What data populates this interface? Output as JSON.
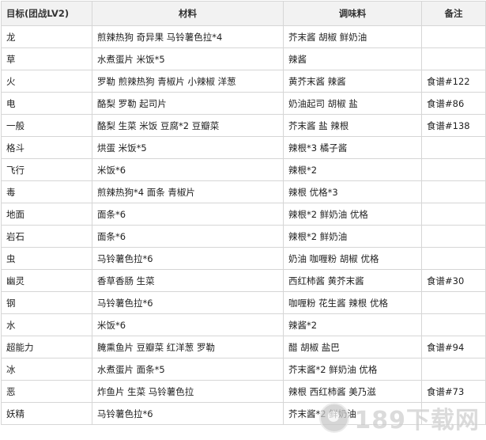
{
  "table": {
    "headers": [
      "目标(团战LV2)",
      "材料",
      "调味料",
      "备注"
    ],
    "rows": [
      [
        "龙",
        "煎辣热狗 奇异果 马铃薯色拉*4",
        "芥末酱 胡椒 鲜奶油",
        ""
      ],
      [
        "草",
        "水煮蛋片 米饭*5",
        "辣酱",
        ""
      ],
      [
        "火",
        "罗勒 煎辣热狗 青椒片 小辣椒 洋葱",
        "黄芥末酱 辣酱",
        "食谱#122"
      ],
      [
        "电",
        "酪梨 罗勒 起司片",
        "奶油起司 胡椒 盐",
        "食谱#86"
      ],
      [
        "一般",
        "酪梨 生菜 米饭 豆腐*2 豆瓣菜",
        "芥末酱 盐 辣根",
        "食谱#138"
      ],
      [
        "格斗",
        "烘蛋 米饭*5",
        "辣根*3 橘子酱",
        ""
      ],
      [
        "飞行",
        "米饭*6",
        "辣根*2",
        ""
      ],
      [
        "毒",
        "煎辣热狗*4 面条 青椒片",
        "辣根 优格*3",
        ""
      ],
      [
        "地面",
        "面条*6",
        "辣根*2 鲜奶油 优格",
        ""
      ],
      [
        "岩石",
        "面条*6",
        "辣根*2 鲜奶油",
        ""
      ],
      [
        "虫",
        "马铃薯色拉*6",
        "奶油 咖喱粉 胡椒 优格",
        ""
      ],
      [
        "幽灵",
        "香草香肠 生菜",
        "西红柿酱 黄芥末酱",
        "食谱#30"
      ],
      [
        "钢",
        "马铃薯色拉*6",
        "咖喱粉 花生酱 辣根 优格",
        ""
      ],
      [
        "水",
        "米饭*6",
        "辣酱*2",
        ""
      ],
      [
        "超能力",
        "腌熏鱼片 豆瓣菜 红洋葱 罗勒",
        "醋 胡椒 盐巴",
        "食谱#94"
      ],
      [
        "冰",
        "水煮蛋片 面条*5",
        "芥末酱*2 鲜奶油 优格",
        ""
      ],
      [
        "恶",
        "炸鱼片 生菜 马铃薯色拉",
        "辣根 西红柿酱 美乃滋",
        "食谱#73"
      ],
      [
        "妖精",
        "马铃薯色拉*6",
        "芥末酱*2 鲜奶油",
        ""
      ]
    ]
  },
  "watermark": {
    "text": "189下载网",
    "icon": "site-logo-icon"
  },
  "colors": {
    "header_bg": "#f2f2f2",
    "border": "#d6d6d6",
    "text": "#222222"
  }
}
